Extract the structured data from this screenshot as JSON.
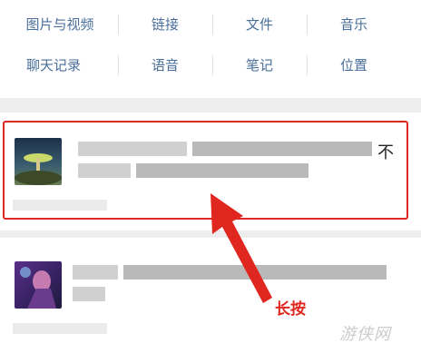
{
  "categories": [
    {
      "label": "图片与视频"
    },
    {
      "label": "链接"
    },
    {
      "label": "文件"
    },
    {
      "label": "音乐"
    },
    {
      "label": "聊天记录"
    },
    {
      "label": "语音"
    },
    {
      "label": "笔记"
    },
    {
      "label": "位置"
    }
  ],
  "results": [
    {
      "lead": "「",
      "trail": "不"
    },
    {
      "lead": "",
      "trail": ""
    }
  ],
  "annotation": {
    "text": "长按",
    "color": "#e0271f"
  },
  "watermark": {
    "text": "游侠网"
  },
  "colors": {
    "link": "#4a6f9a",
    "highlight": "#e0271f",
    "background": "#ededed"
  }
}
